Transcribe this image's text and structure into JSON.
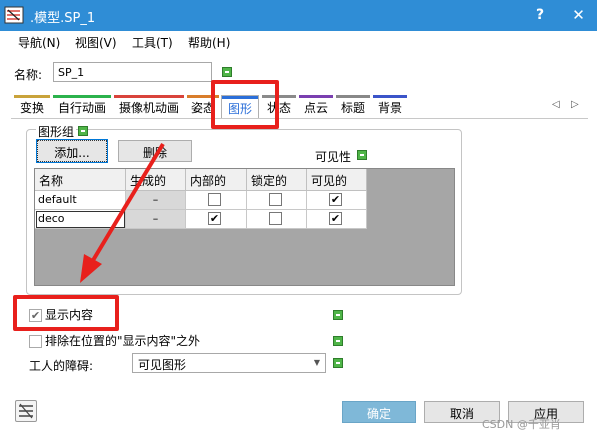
{
  "window": {
    "title": ".模型.SP_1",
    "help_glyph": "?",
    "close_glyph": "✕",
    "app_icon": "model-icon"
  },
  "menu": {
    "items": [
      "导航(N)",
      "视图(V)",
      "工具(T)",
      "帮助(H)"
    ]
  },
  "name_field": {
    "label": "名称:",
    "value": "SP_1"
  },
  "tabs": {
    "items": [
      {
        "label": "变换",
        "color": "#c9a33b"
      },
      {
        "label": "自行动画",
        "color": "#2bb24c"
      },
      {
        "label": "摄像机动画",
        "color": "#d9433b"
      },
      {
        "label": "姿态",
        "color": "#d97d2a"
      },
      {
        "label": "图形",
        "color": "#2b6fd9"
      },
      {
        "label": "状态",
        "color": "#8a8a8a"
      },
      {
        "label": "点云",
        "color": "#7a3fb0"
      },
      {
        "label": "标题",
        "color": "#888888"
      },
      {
        "label": "背景",
        "color": "#3b54c9"
      }
    ],
    "active": "图形",
    "scroll_left": "◁",
    "scroll_right": "▷"
  },
  "graphics_group": {
    "title": "图形组",
    "add_button": "添加...",
    "delete_button": "删除",
    "visibility_label": "可见性",
    "columns": [
      "名称",
      "生成的",
      "内部的",
      "锁定的",
      "可见的"
    ],
    "rows": [
      {
        "name": "default",
        "generated": "–",
        "internal": false,
        "locked": false,
        "visible": true
      },
      {
        "name": "deco",
        "generated": "–",
        "internal": true,
        "locked": false,
        "visible": true
      }
    ]
  },
  "options": {
    "show_content": {
      "label": "显示内容",
      "checked": true
    },
    "exclude_content": {
      "label": "排除在位置的\"显示内容\"之外",
      "checked": false
    },
    "obstacle": {
      "label": "工人的障碍:",
      "value": "可见图形"
    }
  },
  "footer": {
    "ok": "确定",
    "cancel": "取消",
    "apply": "应用"
  },
  "watermark": "CSDN @千亚肖",
  "colors": {
    "titlebar": "#2f8dd6",
    "highlight": "#e8201c",
    "green": "#4fb548"
  }
}
